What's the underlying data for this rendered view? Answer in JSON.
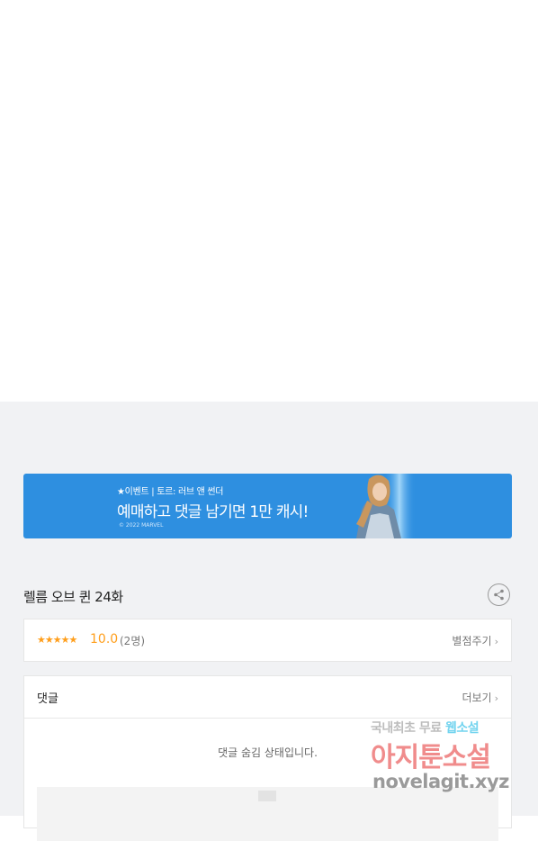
{
  "banner": {
    "event_line": "★이벤트 | 토르: 러브 앤 썬더",
    "headline": "예매하고 댓글 남기면 1만 캐시!",
    "copyright": "© 2022 MARVEL"
  },
  "episode": {
    "title": "렐름 오브 퀸 24화"
  },
  "rating": {
    "stars": "★★★★★",
    "score": "10.0",
    "count": "(2명)",
    "rate_link": "별점주기"
  },
  "comments": {
    "title": "댓글",
    "more_link": "더보기",
    "hidden_message": "댓글 숨김 상태입니다."
  },
  "watermark": {
    "line1_prefix": "국내최초 무료 ",
    "line1_highlight": "웹소설",
    "line2": "아지툰소설",
    "line3": "novelagit.xyz"
  },
  "colors": {
    "banner_bg": "#2e8fe0",
    "star": "#ff9e1b",
    "page_gray": "#f1f2f4"
  }
}
